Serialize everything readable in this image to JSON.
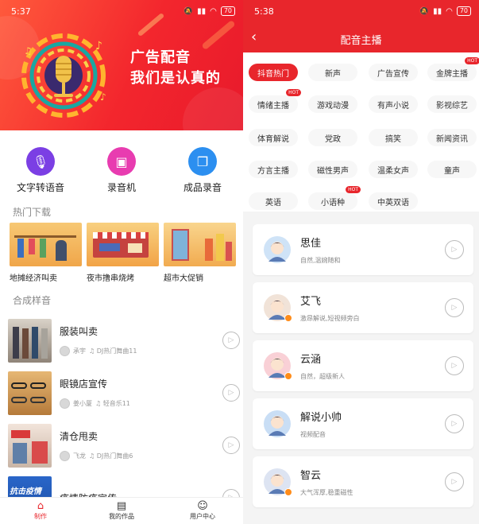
{
  "left": {
    "status": {
      "time": "5:37",
      "battery": "70"
    },
    "banner": {
      "line1": "广告配音",
      "line2": "我们是认真的"
    },
    "tools": [
      {
        "label": "文字转语音",
        "color": "#7b3fe4",
        "icon": "microphone-icon",
        "glyph": "🎙"
      },
      {
        "label": "录音机",
        "color": "#e83cb0",
        "icon": "recorder-icon",
        "glyph": "▣"
      },
      {
        "label": "成品录音",
        "color": "#2c8ff0",
        "icon": "audio-file-icon",
        "glyph": "❐"
      }
    ],
    "hot_downloads_title": "热门下载",
    "downloads": [
      {
        "label": "地摊经济叫卖"
      },
      {
        "label": "夜市撸串烧烤"
      },
      {
        "label": "超市大促销"
      }
    ],
    "samples_title": "合成样音",
    "samples": [
      {
        "title": "服装叫卖",
        "author": "承宇",
        "music": "♫ DJ热门舞曲11"
      },
      {
        "title": "眼镜店宣传",
        "author": "姜小厦",
        "music": "♫ 轻音乐11"
      },
      {
        "title": "清仓甩卖",
        "author": "飞龙",
        "music": "♫ DJ热门舞曲6"
      },
      {
        "title": "疫情防疫宣传",
        "author": "",
        "music": "",
        "thumb_text": "抗击疫情"
      }
    ],
    "tabbar": [
      {
        "label": "制作",
        "icon": "home-icon",
        "glyph": "⌂",
        "active": true
      },
      {
        "label": "我的作品",
        "icon": "works-icon",
        "glyph": "▤",
        "active": false
      },
      {
        "label": "用户中心",
        "icon": "user-icon",
        "glyph": "☺",
        "active": false
      }
    ]
  },
  "right": {
    "status": {
      "time": "5:38",
      "battery": "70"
    },
    "title": "配音主播",
    "back": "‹",
    "hot_label": "HOT",
    "tags": [
      {
        "label": "抖音热门",
        "active": true,
        "hot": false
      },
      {
        "label": "新声",
        "active": false,
        "hot": false
      },
      {
        "label": "广告宣传",
        "active": false,
        "hot": false
      },
      {
        "label": "金牌主播",
        "active": false,
        "hot": true
      },
      {
        "label": "情绪主播",
        "active": false,
        "hot": true
      },
      {
        "label": "游戏动漫",
        "active": false,
        "hot": false
      },
      {
        "label": "有声小说",
        "active": false,
        "hot": false
      },
      {
        "label": "影视综艺",
        "active": false,
        "hot": false
      },
      {
        "label": "体育解说",
        "active": false,
        "hot": false
      },
      {
        "label": "党政",
        "active": false,
        "hot": false
      },
      {
        "label": "搞笑",
        "active": false,
        "hot": false
      },
      {
        "label": "新闻资讯",
        "active": false,
        "hot": false
      },
      {
        "label": "方言主播",
        "active": false,
        "hot": false
      },
      {
        "label": "磁性男声",
        "active": false,
        "hot": false
      },
      {
        "label": "温柔女声",
        "active": false,
        "hot": false
      },
      {
        "label": "童声",
        "active": false,
        "hot": false
      },
      {
        "label": "英语",
        "active": false,
        "hot": false
      },
      {
        "label": "小语种",
        "active": false,
        "hot": true
      },
      {
        "label": "中英双语",
        "active": false,
        "hot": false
      }
    ],
    "anchors": [
      {
        "name": "思佳",
        "desc": "自然,温婉随和",
        "avatar_color": "#cfe3f7",
        "badge": false
      },
      {
        "name": "艾飞",
        "desc": "激昂解说,短视频旁白",
        "avatar_color": "#f1e3d8",
        "badge": true
      },
      {
        "name": "云涵",
        "desc": "自然，超级新人",
        "avatar_color": "#f9d0d6",
        "badge": true
      },
      {
        "name": "解说小帅",
        "desc": "视频配音",
        "avatar_color": "#c9def5",
        "badge": false
      },
      {
        "name": "智云",
        "desc": "大气浑厚,稳重磁性",
        "avatar_color": "#dde4f2",
        "badge": true
      }
    ]
  }
}
